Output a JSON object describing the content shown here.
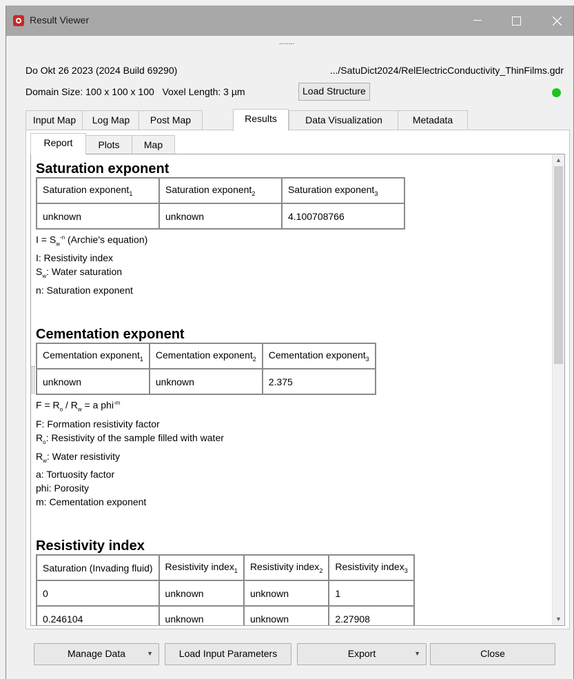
{
  "window": {
    "title": "Result Viewer"
  },
  "info": {
    "date_build": "Do Okt 26 2023 (2024 Build 69290)",
    "path": ".../SatuDict2024/RelElectricConductivity_ThinFilms.gdr",
    "domain_size": "Domain Size: 100 x 100 x 100   Voxel Length: 3 µm",
    "load_structure_label": "Load Structure",
    "status_color": "#1fc21f"
  },
  "tabs": [
    "Input Map",
    "Log Map",
    "Post Map",
    "Results",
    "Data Visualization",
    "Metadata"
  ],
  "active_tab": "Results",
  "subtabs": [
    "Report",
    "Plots",
    "Map"
  ],
  "active_subtab": "Report",
  "report": {
    "saturation": {
      "heading": "Saturation exponent",
      "headers": [
        "Saturation exponent",
        "Saturation exponent",
        "Saturation exponent"
      ],
      "header_subs": [
        "1",
        "2",
        "3"
      ],
      "values": [
        "unknown",
        "unknown",
        "4.100708766"
      ],
      "legend": {
        "eq_a": "I = S",
        "eq_sub": "w",
        "eq_sup": "-n",
        "eq_b": " (Archie's equation)",
        "l1": "I: Resistivity index",
        "l2_a": "S",
        "l2_sub": "w",
        "l2_b": ": Water saturation",
        "l3": "n: Saturation exponent"
      }
    },
    "cementation": {
      "heading": "Cementation exponent",
      "headers": [
        "Cementation exponent",
        "Cementation exponent",
        "Cementation exponent"
      ],
      "header_subs": [
        "1",
        "2",
        "3"
      ],
      "values": [
        "unknown",
        "unknown",
        "2.375"
      ],
      "legend": {
        "eq_a": "F = R",
        "eq_sub1": "o",
        "eq_b": " / R",
        "eq_sub2": "w",
        "eq_c": " = a phi",
        "eq_sup": "-m",
        "l1": "F: Formation resistivity factor",
        "l2_a": "R",
        "l2_sub": "o",
        "l2_b": ": Resistivity of the sample filled with water",
        "l3_a": "R",
        "l3_sub": "w",
        "l3_b": ": Water resistivity",
        "l4": "a: Tortuosity factor",
        "l5": "phi: Porosity",
        "l6": "m: Cementation exponent"
      }
    },
    "resistivity": {
      "heading": "Resistivity index",
      "headers": [
        "Saturation (Invading fluid)",
        "Resistivity index",
        "Resistivity index",
        "Resistivity index"
      ],
      "header_subs": [
        "",
        "1",
        "2",
        "3"
      ],
      "rows": [
        [
          "0",
          "unknown",
          "unknown",
          "1"
        ],
        [
          "0.246104",
          "unknown",
          "unknown",
          "2.27908"
        ]
      ]
    }
  },
  "buttons": {
    "manage_data": "Manage Data",
    "load_input": "Load Input Parameters",
    "export": "Export",
    "close": "Close"
  }
}
